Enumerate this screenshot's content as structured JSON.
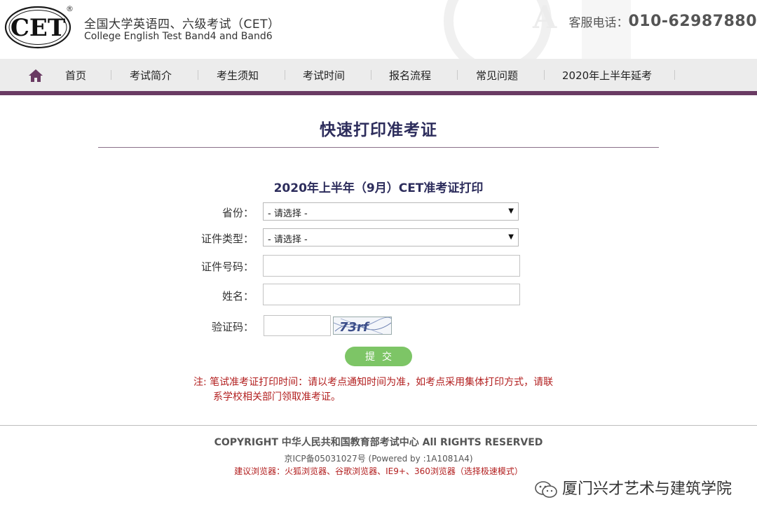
{
  "header": {
    "logo_text": "CET",
    "logo_reg": "®",
    "title": "全国大学英语四、六级考试（CET）",
    "subtitle": "College English Test Band4 and Band6",
    "phone_label": "客服电话：",
    "phone_number": "010-62987880"
  },
  "nav": {
    "home_icon": "home-icon",
    "items": [
      "首页",
      "考试简介",
      "考生须知",
      "考试时间",
      "报名流程",
      "常见问题",
      "2020年上半年延考"
    ]
  },
  "main": {
    "page_title": "快速打印准考证",
    "form_heading": "2020年上半年（9月）CET准考证打印",
    "fields": {
      "province_label": "省份：",
      "province_value": "- 请选择 -",
      "id_type_label": "证件类型：",
      "id_type_value": "- 请选择 -",
      "id_number_label": "证件号码：",
      "id_number_value": "",
      "name_label": "姓名：",
      "name_value": "",
      "captcha_label": "验证码：",
      "captcha_value": "",
      "captcha_image_text": "73rf"
    },
    "submit_label": "提交",
    "note_line1": "注: 笔试准考证打印时间：请以考点通知时间为准，如考点采用集体打印方式，请联",
    "note_line2": "系学校相关部门领取准考证。"
  },
  "footer": {
    "copyright": "COPYRIGHT 中华人民共和国教育部考试中心 All RIGHTS RESERVED",
    "icp": "京ICP备05031027号 (Powered by :1A1081A4)",
    "browsers": "建议浏览器：火狐浏览器、谷歌浏览器、IE9+、360浏览器（选择极速模式）",
    "watermark": "厦门兴才艺术与建筑学院"
  },
  "colors": {
    "nav_accent": "#6a3b63",
    "title_color": "#2d2d5c",
    "note_red": "#b21e1e",
    "submit_green": "#7dc566"
  }
}
